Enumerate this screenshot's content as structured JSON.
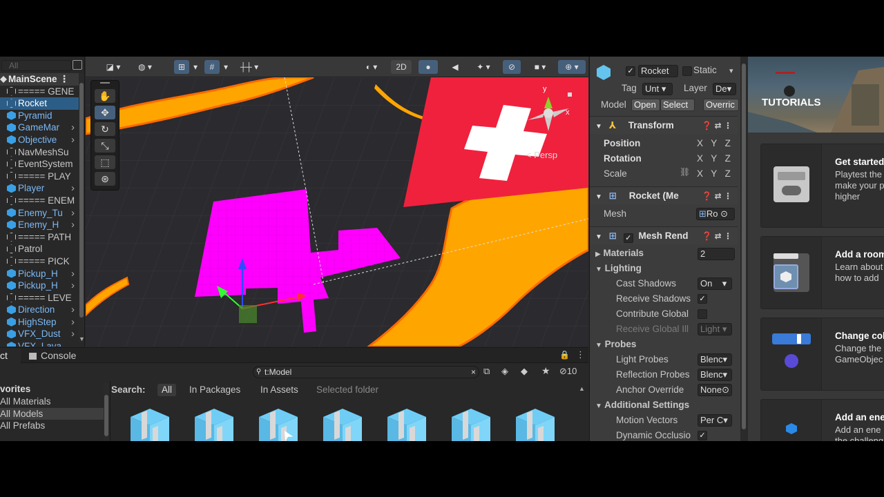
{
  "hierarchy": {
    "search_placeholder": "All",
    "scene_name": "MainScene",
    "items": [
      {
        "label": "===== GENE",
        "type": "wire",
        "blue": false,
        "arrow": false
      },
      {
        "label": "Rocket",
        "type": "wire",
        "blue": false,
        "arrow": false,
        "selected": true
      },
      {
        "label": "Pyramid",
        "type": "blue",
        "blue": true,
        "arrow": false
      },
      {
        "label": "GameMar",
        "type": "blue",
        "blue": true,
        "arrow": true
      },
      {
        "label": "Objective",
        "type": "blue",
        "blue": true,
        "arrow": true
      },
      {
        "label": "NavMeshSu",
        "type": "wire",
        "blue": false,
        "arrow": false
      },
      {
        "label": "EventSystem",
        "type": "wire",
        "blue": false,
        "arrow": false
      },
      {
        "label": "===== PLAY",
        "type": "wire",
        "blue": false,
        "arrow": false
      },
      {
        "label": "Player",
        "type": "blue",
        "blue": true,
        "arrow": true
      },
      {
        "label": "===== ENEM",
        "type": "wire",
        "blue": false,
        "arrow": false
      },
      {
        "label": "Enemy_Tu",
        "type": "blue",
        "blue": true,
        "arrow": true
      },
      {
        "label": "Enemy_H",
        "type": "blue",
        "blue": true,
        "arrow": true
      },
      {
        "label": "===== PATH",
        "type": "wire",
        "blue": false,
        "arrow": false
      },
      {
        "label": "Patrol",
        "type": "wire",
        "blue": false,
        "arrow": false
      },
      {
        "label": "===== PICK",
        "type": "wire",
        "blue": false,
        "arrow": false
      },
      {
        "label": "Pickup_H",
        "type": "blue",
        "blue": true,
        "arrow": true
      },
      {
        "label": "Pickup_H",
        "type": "blue",
        "blue": true,
        "arrow": true
      },
      {
        "label": "===== LEVE",
        "type": "wire",
        "blue": false,
        "arrow": false
      },
      {
        "label": "Direction",
        "type": "blue",
        "blue": true,
        "arrow": true
      },
      {
        "label": "HighStep",
        "type": "blue",
        "blue": true,
        "arrow": true
      },
      {
        "label": "VFX_Dust",
        "type": "blue",
        "blue": true,
        "arrow": true
      },
      {
        "label": "VFX_Lava",
        "type": "blue",
        "blue": true,
        "arrow": false
      }
    ]
  },
  "scene_toolbar": {
    "btn_2d": "2D"
  },
  "scene_view": {
    "persp_label": "< Persp",
    "gizmo_y": "y",
    "gizmo_x": "x",
    "colors": {
      "lava": "#ffa500",
      "magenta": "#ff00ff",
      "red_plane": "#f0213d"
    }
  },
  "inspector": {
    "object_name": "Rocket",
    "static_label": "Static",
    "tag_label": "Tag",
    "tag_value": "Unt",
    "layer_label": "Layer",
    "layer_value": "De",
    "model_label": "Model",
    "open_btn": "Open",
    "select_btn": "Select",
    "overrides_btn": "Overric",
    "transform": {
      "title": "Transform",
      "position": "Position",
      "rotation": "Rotation",
      "scale": "Scale",
      "x": "X",
      "y": "Y",
      "z": "Z"
    },
    "mesh_filter": {
      "title": "Rocket (Me",
      "mesh_label": "Mesh",
      "mesh_value": "Ro"
    },
    "mesh_renderer": {
      "title": "Mesh Rend",
      "materials_label": "Materials",
      "materials_count": "2",
      "lighting": "Lighting",
      "cast_shadows": "Cast Shadows",
      "cast_shadows_value": "On",
      "receive_shadows": "Receive Shadows",
      "contribute_global": "Contribute Global",
      "receive_global": "Receive Global Ill",
      "receive_global_value": "Light",
      "probes": "Probes",
      "light_probes": "Light Probes",
      "light_probes_value": "Blenc",
      "reflection_probes": "Reflection Probes",
      "reflection_probes_value": "Blenc",
      "anchor_override": "Anchor Override",
      "anchor_override_value": "None",
      "additional_settings": "Additional Settings",
      "motion_vectors": "Motion Vectors",
      "motion_vectors_value": "Per C",
      "dynamic_occlusion": "Dynamic Occlusio"
    }
  },
  "tutorials": {
    "title": "TUTORIALS",
    "cards": [
      {
        "title": "Get started",
        "desc1": "Playtest the",
        "desc2": "make your p",
        "desc3": "higher"
      },
      {
        "title": "Add a room",
        "desc1": "Learn about",
        "desc2": "how to add"
      },
      {
        "title": "Change col",
        "desc1": "Change the",
        "desc2": "GameObjec"
      },
      {
        "title": "Add an ene",
        "desc1": "Add an ene",
        "desc2": "the challeng"
      }
    ]
  },
  "project": {
    "tab_project": "ct",
    "tab_console": "Console",
    "search_value": "t:Model",
    "hidden_count": "10",
    "favorites_title": "vorites",
    "favorites": [
      "All Materials",
      "All Models",
      "All Prefabs"
    ],
    "search_label": "Search:",
    "scopes": [
      "All",
      "In Packages",
      "In Assets",
      "Selected folder"
    ],
    "asset_count": 7
  }
}
